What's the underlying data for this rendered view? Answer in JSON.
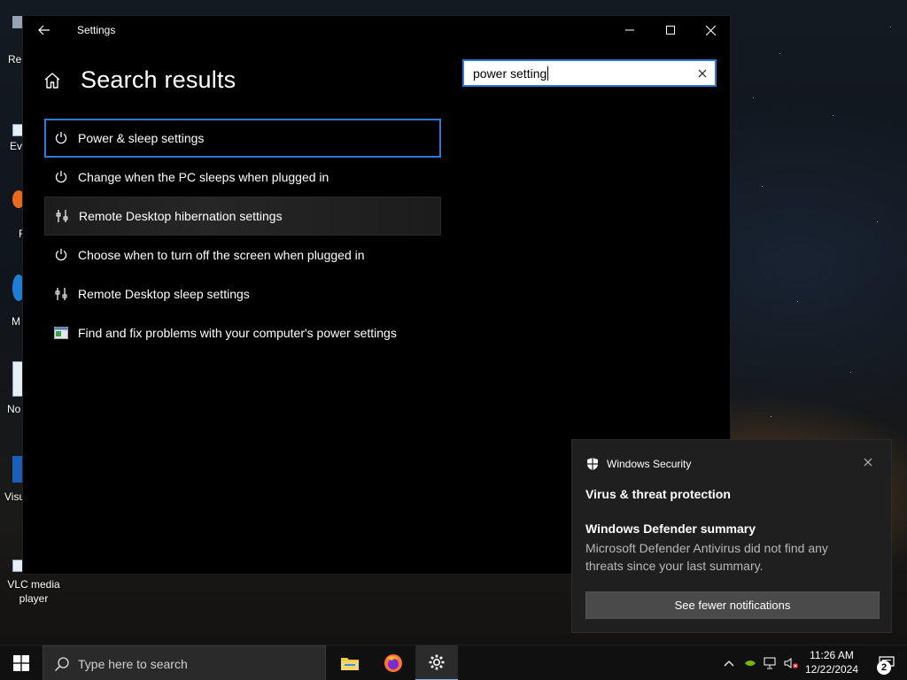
{
  "window": {
    "title": "Settings",
    "page_title": "Search results"
  },
  "search": {
    "value": "power setting"
  },
  "results": [
    {
      "label": "Power & sleep settings",
      "icon": "power-icon"
    },
    {
      "label": "Change when the PC sleeps when plugged in",
      "icon": "power-icon"
    },
    {
      "label": "Remote Desktop hibernation settings",
      "icon": "remote-desktop-icon"
    },
    {
      "label": "Choose when to turn off the screen when plugged in",
      "icon": "power-icon"
    },
    {
      "label": "Remote Desktop sleep settings",
      "icon": "remote-desktop-icon"
    },
    {
      "label": "Find and fix problems with your computer's power settings",
      "icon": "troubleshoot-icon"
    }
  ],
  "desktop_icons": [
    {
      "label": "Re",
      "icon": "recycle-bin-icon"
    },
    {
      "label": "Eve",
      "icon": "shortcut-icon"
    },
    {
      "label": "F",
      "icon": "firefox-shortcut-icon"
    },
    {
      "label": "M",
      "icon": "edge-shortcut-icon"
    },
    {
      "label": "No",
      "icon": "notepad-shortcut-icon"
    },
    {
      "label": "Visu",
      "icon": "vscode-shortcut-icon"
    }
  ],
  "vlc": {
    "label": "VLC media player"
  },
  "toast": {
    "app_name": "Windows Security",
    "heading": "Virus & threat protection",
    "title": "Windows Defender summary",
    "body": "Microsoft Defender Antivirus did not find any threats since your last summary.",
    "button_label": "See fewer notifications"
  },
  "taskbar": {
    "search_placeholder": "Type here to search",
    "apps": [
      "file-explorer-icon",
      "firefox-icon",
      "settings-icon"
    ],
    "time": "11:26 AM",
    "date": "12/22/2024",
    "notification_count": "2"
  },
  "colors": {
    "accent": "#2f7ad6",
    "window_bg": "#000000",
    "toast_bg": "#1f1f1f"
  }
}
